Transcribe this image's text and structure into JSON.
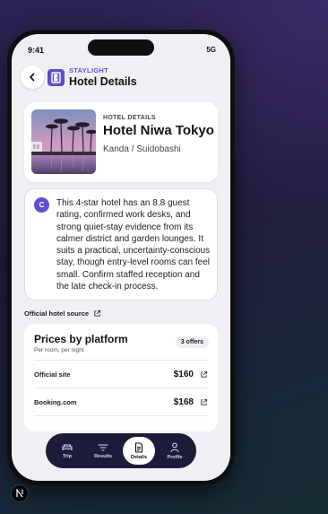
{
  "status_bar": {
    "time": "9:41",
    "network": "5G"
  },
  "header": {
    "brand": "STAYLIGHT",
    "title": "Hotel Details"
  },
  "hotel": {
    "section_label": "HOTEL DETAILS",
    "name": "Hotel Niwa Tokyo",
    "area": "Kanda / Suidobashi"
  },
  "description": {
    "avatar_letter": "C",
    "text": "This 4-star hotel has an 8.8 guest rating, confirmed work desks, and strong quiet-stay evidence from its calmer district and garden lounges. It suits a practical, uncertainty-conscious stay, though entry-level rooms can feel small. Confirm staffed reception and the late check-in process."
  },
  "source_link": "Official hotel source",
  "prices": {
    "title": "Prices by platform",
    "subtitle": "Per room, per night",
    "offers_badge": "3 offers",
    "rows": [
      {
        "platform": "Official site",
        "price": "$160"
      },
      {
        "platform": "Booking.com",
        "price": "$168"
      }
    ]
  },
  "tabs": [
    {
      "label": "Trip",
      "icon": "bed-icon"
    },
    {
      "label": "Results",
      "icon": "filter-icon"
    },
    {
      "label": "Details",
      "icon": "document-icon",
      "active": true
    },
    {
      "label": "Profile",
      "icon": "person-icon"
    }
  ],
  "colors": {
    "accent": "#5a4fcf",
    "tabbar": "#1c1c3a"
  }
}
